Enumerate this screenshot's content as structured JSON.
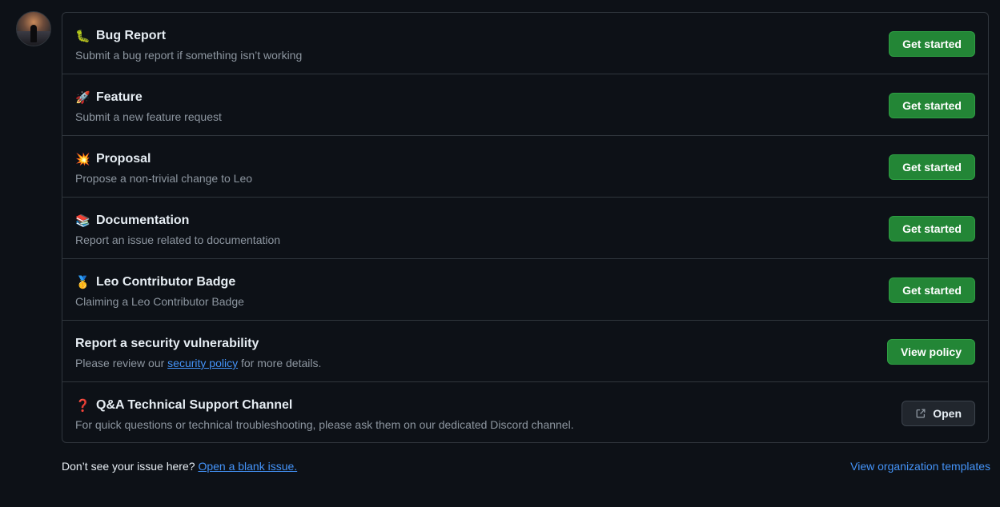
{
  "templates": [
    {
      "emoji": "🐛",
      "icon": "bug-emoji-icon",
      "title": "Bug Report",
      "description": "Submit a bug report if something isn’t working",
      "button": "Get started"
    },
    {
      "emoji": "🚀",
      "icon": "rocket-emoji-icon",
      "title": "Feature",
      "description": "Submit a new feature request",
      "button": "Get started"
    },
    {
      "emoji": "💥",
      "icon": "collision-emoji-icon",
      "title": "Proposal",
      "description": "Propose a non-trivial change to Leo",
      "button": "Get started"
    },
    {
      "emoji": "📚",
      "icon": "books-emoji-icon",
      "title": "Documentation",
      "description": "Report an issue related to documentation",
      "button": "Get started"
    },
    {
      "emoji": "🥇",
      "icon": "medal-emoji-icon",
      "title": "Leo Contributor Badge",
      "description": "Claiming a Leo Contributor Badge",
      "button": "Get started"
    }
  ],
  "security": {
    "title": "Report a security vulnerability",
    "desc_prefix": "Please review our ",
    "link": "security policy",
    "desc_suffix": " for more details.",
    "button": "View policy"
  },
  "support": {
    "emoji": "❓",
    "icon": "question-emoji-icon",
    "title": "Q&A Technical Support Channel",
    "description": "For quick questions or technical troubleshooting, please ask them on our dedicated Discord channel.",
    "button": "Open"
  },
  "footer": {
    "prefix": "Don’t see your issue here? ",
    "blank_link": "Open a blank issue.",
    "org_templates": "View organization templates"
  },
  "colors": {
    "background": "#0d1117",
    "border": "#30363d",
    "button_green": "#238636",
    "link": "#4493f8",
    "muted_text": "#8d96a0"
  }
}
